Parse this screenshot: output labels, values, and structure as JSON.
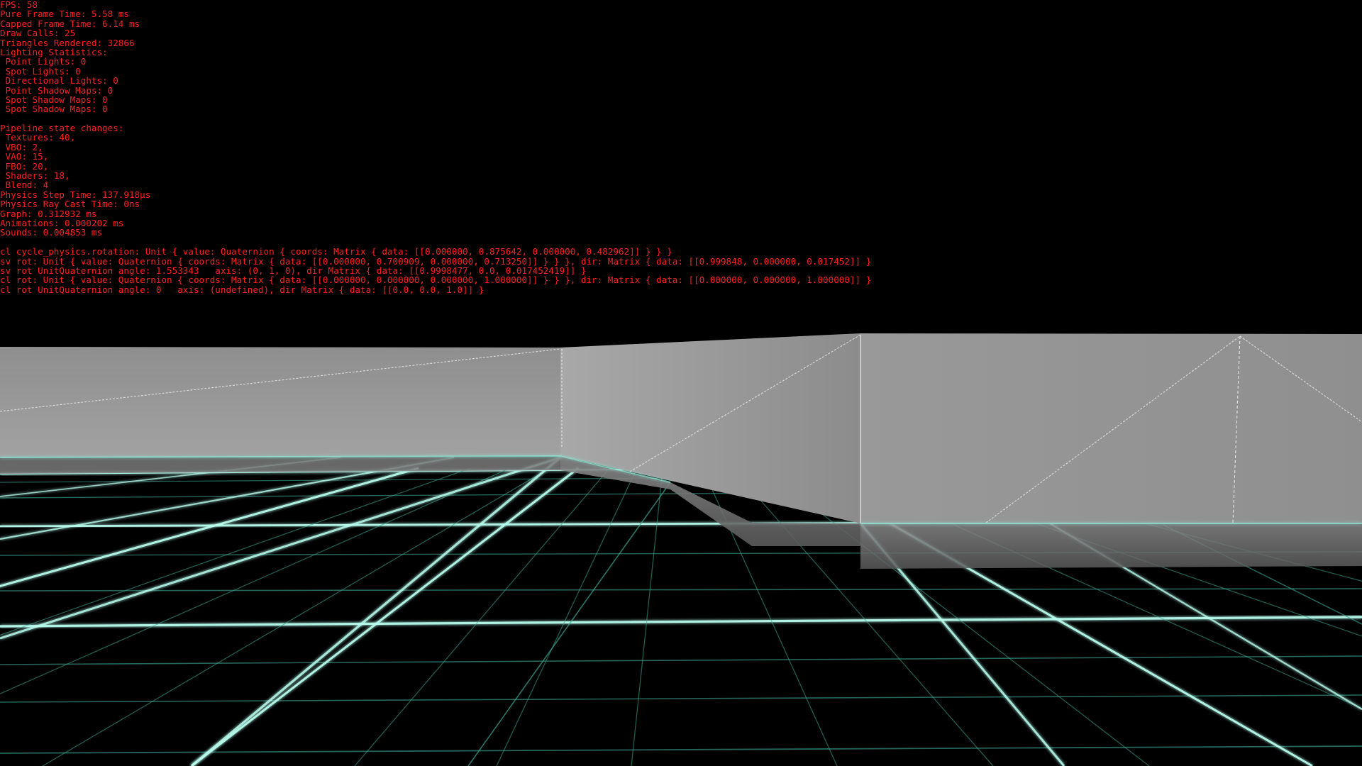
{
  "colors": {
    "background": "#000000",
    "debug_text": "#ff1f1f",
    "grid_major": "#b9fff0",
    "grid_minor": "#3fa896",
    "wall_base": "#9a9a9a",
    "wall_edge": "#e6e6e6"
  },
  "debug_overlay": {
    "lines": [
      "FPS: 58",
      "Pure Frame Time: 5.58 ms",
      "Capped Frame Time: 6.14 ms",
      "Draw Calls: 25",
      "Triangles Rendered: 32866",
      "Lighting Statistics:",
      " Point Lights: 0",
      " Spot Lights: 0",
      " Directional Lights: 0",
      " Point Shadow Maps: 0",
      " Spot Shadow Maps: 0",
      " Spot Shadow Maps: 0",
      "",
      "Pipeline state changes:",
      " Textures: 40,",
      " VBO: 2,",
      " VAO: 15,",
      " FBO: 20,",
      " Shaders: 18,",
      " Blend: 4",
      "Physics Step Time: 137.918µs",
      "Physics Ray Cast Time: 0ns",
      "Graph: 0.312932 ms",
      "Animations: 0.000202 ms",
      "Sounds: 0.004853 ms",
      "",
      "cl cycle_physics.rotation: Unit { value: Quaternion { coords: Matrix { data: [[0.000000, 0.875642, 0.000000, 0.482962]] } } }",
      "sv rot: Unit { value: Quaternion { coords: Matrix { data: [[0.000000, 0.700909, 0.000000, 0.713250]] } } }, dir: Matrix { data: [[0.999848, 0.000000, 0.017452]] }",
      "sv rot UnitQuaternion angle: 1.553343   axis: (0, 1, 0), dir Matrix { data: [[0.9998477, 0.0, 0.017452419]] }",
      "cl rot: Unit { value: Quaternion { coords: Matrix { data: [[0.000000, 0.000000, 0.000000, 1.000000]] } } }, dir: Matrix { data: [[0.000000, 0.000000, 1.000000]] }",
      "cl rot UnitQuaternion angle: 0   axis: (undefined), dir Matrix { data: [[0.0, 0.0, 1.0]] }"
    ]
  }
}
